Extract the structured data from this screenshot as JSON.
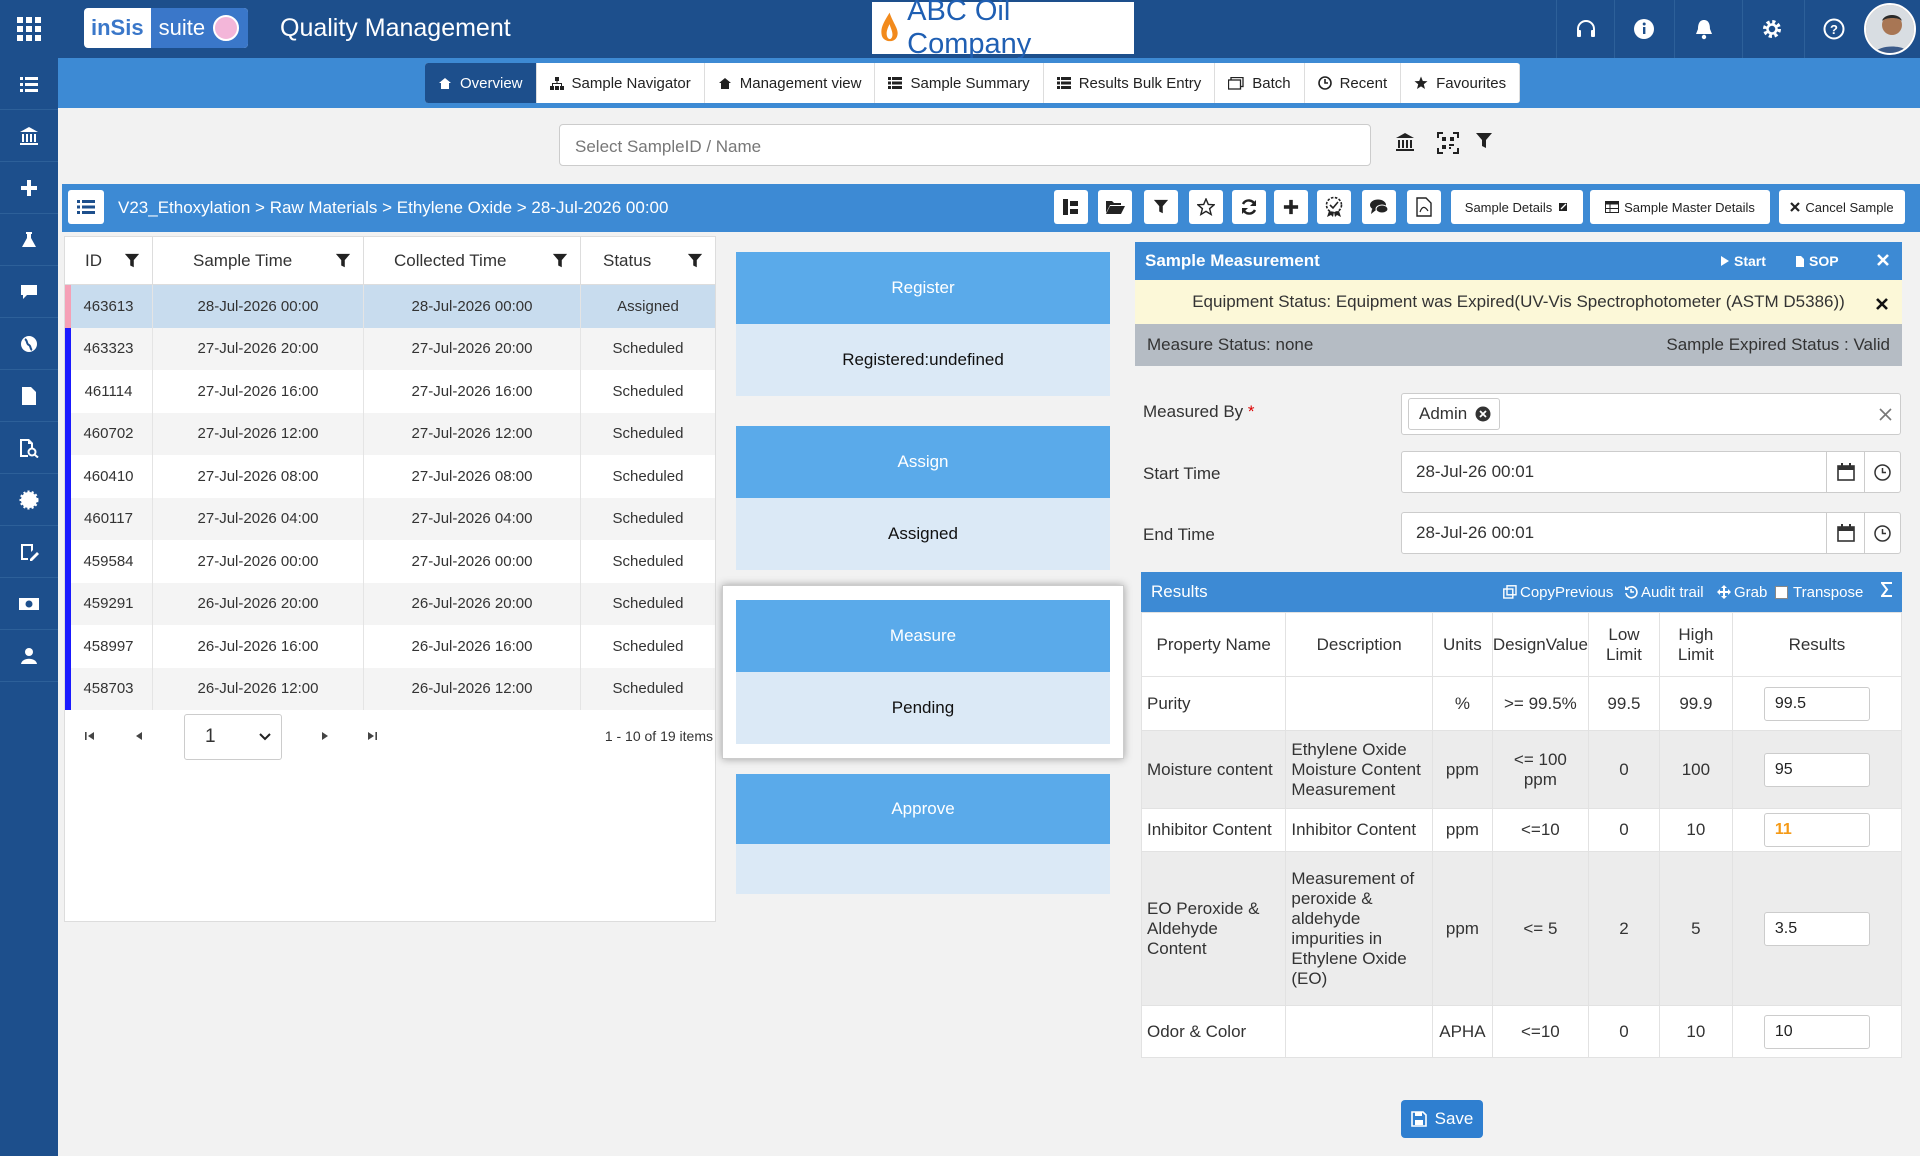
{
  "header": {
    "logo_left": "inSis",
    "logo_right": "suite",
    "app_title": "Quality Management",
    "company": "ABC Oil Company"
  },
  "nav": {
    "tabs": [
      {
        "label": "Overview",
        "icon": "home-icon"
      },
      {
        "label": "Sample Navigator",
        "icon": "sitemap-icon"
      },
      {
        "label": "Management view",
        "icon": "home-icon"
      },
      {
        "label": "Sample Summary",
        "icon": "list-icon"
      },
      {
        "label": "Results Bulk Entry",
        "icon": "list-icon"
      },
      {
        "label": "Batch",
        "icon": "copy-icon"
      },
      {
        "label": "Recent",
        "icon": "clock-icon"
      },
      {
        "label": "Favourites",
        "icon": "star-icon"
      }
    ]
  },
  "search": {
    "placeholder": "Select SampleID / Name"
  },
  "breadcrumb": {
    "text": "V23_Ethoxylation >  Raw Materials >  Ethylene Oxide >  28-Jul-2026 00:00"
  },
  "toolbar": {
    "sample_details": "Sample Details",
    "sample_master_details": "Sample Master Details",
    "cancel_sample": "Cancel Sample"
  },
  "grid": {
    "columns": [
      "ID",
      "Sample Time",
      "Collected Time",
      "Status"
    ],
    "rows": [
      {
        "id": "463613",
        "sample_time": "28-Jul-2026 00:00",
        "collected_time": "28-Jul-2026 00:00",
        "status": "Assigned"
      },
      {
        "id": "463323",
        "sample_time": "27-Jul-2026 20:00",
        "collected_time": "27-Jul-2026 20:00",
        "status": "Scheduled"
      },
      {
        "id": "461114",
        "sample_time": "27-Jul-2026 16:00",
        "collected_time": "27-Jul-2026 16:00",
        "status": "Scheduled"
      },
      {
        "id": "460702",
        "sample_time": "27-Jul-2026 12:00",
        "collected_time": "27-Jul-2026 12:00",
        "status": "Scheduled"
      },
      {
        "id": "460410",
        "sample_time": "27-Jul-2026 08:00",
        "collected_time": "27-Jul-2026 08:00",
        "status": "Scheduled"
      },
      {
        "id": "460117",
        "sample_time": "27-Jul-2026 04:00",
        "collected_time": "27-Jul-2026 04:00",
        "status": "Scheduled"
      },
      {
        "id": "459584",
        "sample_time": "27-Jul-2026 00:00",
        "collected_time": "27-Jul-2026 00:00",
        "status": "Scheduled"
      },
      {
        "id": "459291",
        "sample_time": "26-Jul-2026 20:00",
        "collected_time": "26-Jul-2026 20:00",
        "status": "Scheduled"
      },
      {
        "id": "458997",
        "sample_time": "26-Jul-2026 16:00",
        "collected_time": "26-Jul-2026 16:00",
        "status": "Scheduled"
      },
      {
        "id": "458703",
        "sample_time": "26-Jul-2026 12:00",
        "collected_time": "26-Jul-2026 12:00",
        "status": "Scheduled"
      }
    ],
    "page": "1",
    "items_info": "1 - 10 of 19 items"
  },
  "workflow": [
    {
      "step": "Register",
      "status": "Registered:undefined"
    },
    {
      "step": "Assign",
      "status": "Assigned"
    },
    {
      "step": "Measure",
      "status": "Pending"
    },
    {
      "step": "Approve",
      "status": ""
    }
  ],
  "measurement": {
    "title": "Sample Measurement",
    "start_label": "Start",
    "sop_label": "SOP",
    "equipment_status": "Equipment Status: Equipment was Expired(UV-Vis Spectrophotometer (ASTM D5386))",
    "measure_status": "Measure Status: none",
    "expired_status": "Sample Expired Status : Valid",
    "measured_by_label": "Measured By",
    "measured_by_value": "Admin",
    "start_time_label": "Start Time",
    "start_time_value": "28-Jul-26 00:01",
    "end_time_label": "End Time",
    "end_time_value": "28-Jul-26 00:01"
  },
  "results": {
    "title": "Results",
    "actions": {
      "copy_previous": "CopyPrevious",
      "audit_trail": "Audit trail",
      "grab": "Grab",
      "transpose": "Transpose"
    },
    "columns": {
      "property": "Property Name",
      "description": "Description",
      "units": "Units",
      "design": "DesignValue",
      "low_a": "Low",
      "low_b": "Limit",
      "high_a": "High",
      "high_b": "Limit",
      "results": "Results"
    },
    "rows": [
      {
        "property": "Purity",
        "description": "",
        "units": "%",
        "design": ">= 99.5%",
        "low": "99.5",
        "high": "99.9",
        "result": "99.5",
        "result_color": "#222222"
      },
      {
        "property": "Moisture content",
        "description": "Ethylene Oxide Moisture Content Measurement",
        "units": "ppm",
        "design": "<= 100 ppm",
        "low": "0",
        "high": "100",
        "result": "95",
        "result_color": "#222222"
      },
      {
        "property": "Inhibitor Content",
        "description": "Inhibitor Content",
        "units": "ppm",
        "design": "<=10",
        "low": "0",
        "high": "10",
        "result": "11",
        "result_color": "#f59a16"
      },
      {
        "property": "EO Peroxide & Aldehyde Content",
        "description": "Measurement of peroxide & aldehyde impurities in Ethylene Oxide (EO)",
        "units": "ppm",
        "design": "<= 5",
        "low": "2",
        "high": "5",
        "result": "3.5",
        "result_color": "#222222"
      },
      {
        "property": "Odor & Color",
        "description": "",
        "units": "APHA",
        "design": "<=10",
        "low": "0",
        "high": "10",
        "result": "10",
        "result_color": "#222222"
      }
    ],
    "save_label": "Save"
  },
  "colors": {
    "primary": "#1d4f8c",
    "accent": "#3d8ad4",
    "active_row": "#c8dcee",
    "row_marker": "#1a1aff",
    "warn": "#f59a16"
  }
}
